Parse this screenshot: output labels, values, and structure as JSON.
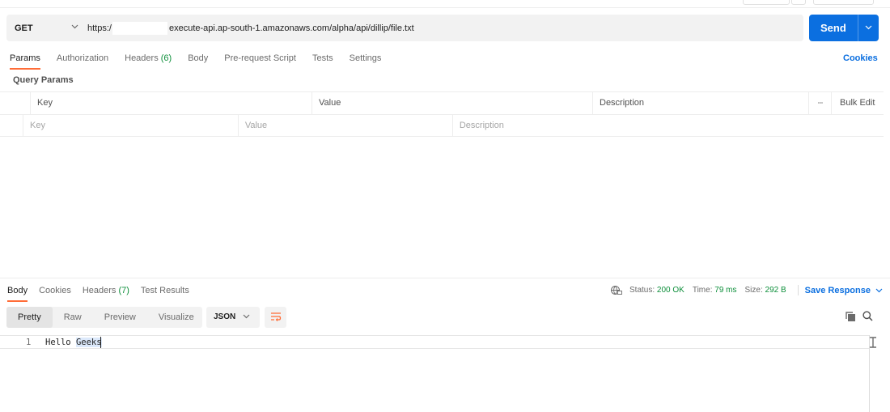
{
  "request": {
    "method": "GET",
    "url_prefix": "https:/",
    "url_rest": "execute-api.ap-south-1.amazonaws.com/alpha/api/dillip/file.txt",
    "send_label": "Send"
  },
  "request_tabs": [
    {
      "label": "Params",
      "count": ""
    },
    {
      "label": "Authorization",
      "count": ""
    },
    {
      "label": "Headers",
      "count": "(6)"
    },
    {
      "label": "Body",
      "count": ""
    },
    {
      "label": "Pre-request Script",
      "count": ""
    },
    {
      "label": "Tests",
      "count": ""
    },
    {
      "label": "Settings",
      "count": ""
    }
  ],
  "cookies_link": "Cookies",
  "query_params": {
    "title": "Query Params",
    "headers": {
      "key": "Key",
      "value": "Value",
      "description": "Description",
      "more": "∙∙∙",
      "bulk_edit": "Bulk Edit"
    },
    "placeholders": {
      "key": "Key",
      "value": "Value",
      "description": "Description"
    }
  },
  "response_tabs": [
    {
      "label": "Body",
      "count": ""
    },
    {
      "label": "Cookies",
      "count": ""
    },
    {
      "label": "Headers",
      "count": "(7)"
    },
    {
      "label": "Test Results",
      "count": ""
    }
  ],
  "response_status": {
    "status_label": "Status:",
    "status_value": "200 OK",
    "time_label": "Time:",
    "time_value": "79 ms",
    "size_label": "Size:",
    "size_value": "292 B",
    "save_label": "Save Response"
  },
  "view_modes": [
    "Pretty",
    "Raw",
    "Preview",
    "Visualize"
  ],
  "format_select": "JSON",
  "response_body": {
    "line_number": "1",
    "text_plain": "Hello ",
    "text_selected": "Geeks"
  },
  "colors": {
    "accent": "#0b6fe0",
    "active_tab_underline": "#ff6c37",
    "success": "#0e8f3b"
  }
}
